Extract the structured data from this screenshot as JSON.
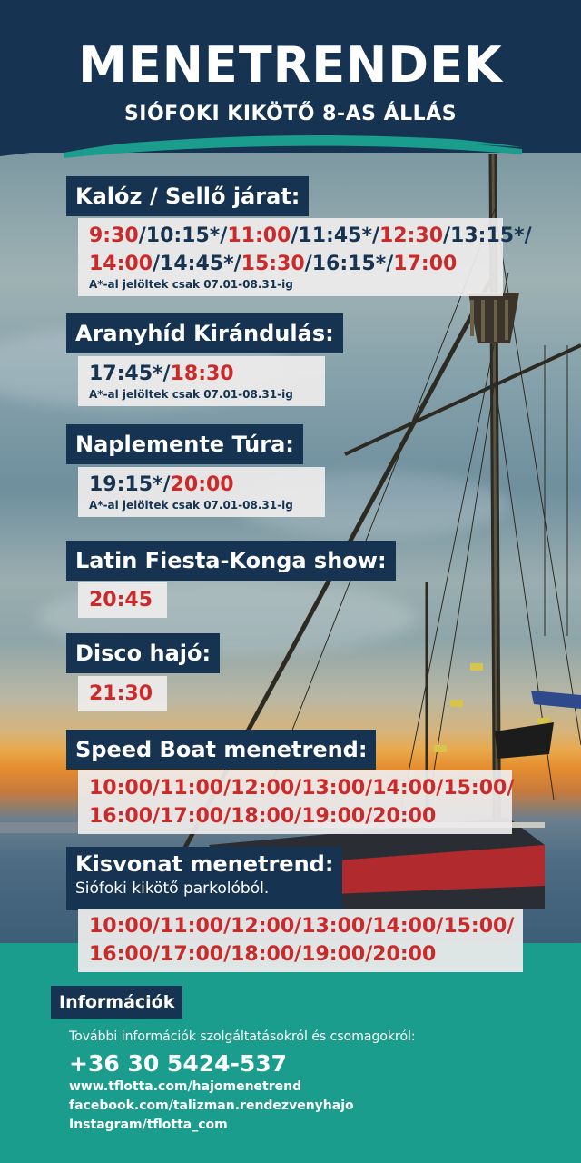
{
  "header": {
    "title": "MENETRENDEK",
    "subtitle": "SIÓFOKI KIKÖTŐ 8-AS ÁLLÁS"
  },
  "schedules": [
    {
      "name": "Kalóz / Sellő járat:",
      "lines": [
        [
          [
            "9:30",
            "r"
          ],
          [
            "/10:15*/",
            "b"
          ],
          [
            "11:00",
            "r"
          ],
          [
            "/11:45*/",
            "b"
          ],
          [
            "12:30",
            "r"
          ],
          [
            "/13:15*/",
            "b"
          ]
        ],
        [
          [
            "14:00",
            "r"
          ],
          [
            "/14:45*/",
            "b"
          ],
          [
            "15:30",
            "r"
          ],
          [
            "/16:15*/",
            "b"
          ],
          [
            "17:00",
            "r"
          ]
        ]
      ],
      "note": "A*-al jelöltek csak 07.01-08.31-ig"
    },
    {
      "name": "Aranyhíd Kirándulás:",
      "lines": [
        [
          [
            "17:45*/",
            "b"
          ],
          [
            "18:30",
            "r"
          ]
        ]
      ],
      "note": "A*-al jelöltek csak 07.01-08.31-ig"
    },
    {
      "name": "Naplemente Túra:",
      "lines": [
        [
          [
            "19:15*/",
            "b"
          ],
          [
            "20:00",
            "r"
          ]
        ]
      ],
      "note": "A*-al jelöltek csak 07.01-08.31-ig"
    },
    {
      "name": "Latin Fiesta-Konga show:",
      "lines": [
        [
          [
            "20:45",
            "r"
          ]
        ]
      ]
    },
    {
      "name": "Disco hajó:",
      "lines": [
        [
          [
            "21:30",
            "r"
          ]
        ]
      ]
    },
    {
      "name": "Speed Boat menetrend:",
      "lines": [
        [
          [
            "10:00/11:00/12:00/13:00/14:00/15:00/",
            "r"
          ]
        ],
        [
          [
            "16:00/17:00/18:00/19:00/20:00",
            "r"
          ]
        ]
      ]
    },
    {
      "name": "Kisvonat menetrend:",
      "subname": "Siófoki kikötő parkolóból.",
      "lines": [
        [
          [
            "10:00/11:00/12:00/13:00/14:00/15:00/",
            "r"
          ]
        ],
        [
          [
            "16:00/17:00/18:00/19:00/20:00",
            "r"
          ]
        ]
      ]
    }
  ],
  "info": {
    "label": "Információk",
    "intro": "További információk szolgáltatásokról és csomagokról:",
    "phone": "+36 30 5424-537",
    "website": "www.tflotta.com/hajomenetrend",
    "facebook": "facebook.com/talizman.rendezvenyhajo",
    "instagram": "Instagram/tflotta_com"
  },
  "colors": {
    "navy": "#163452",
    "red": "#cc2a2a",
    "teal": "#1a9d8c"
  }
}
